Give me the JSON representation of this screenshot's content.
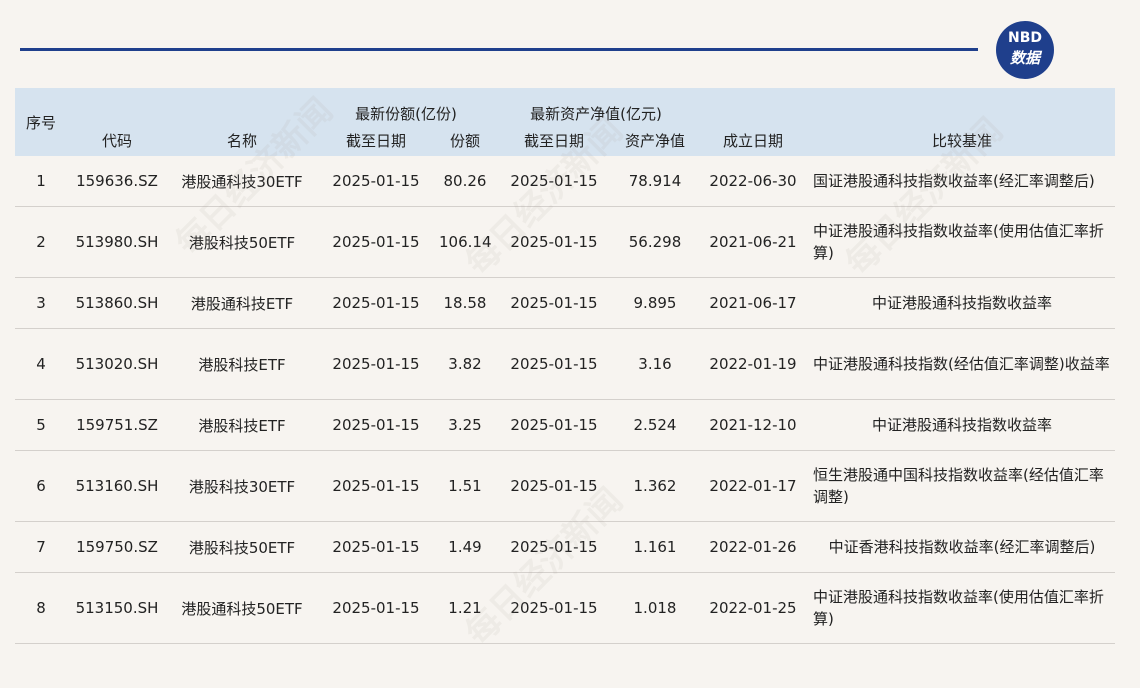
{
  "logo": {
    "top": "NBD",
    "bottom": "数据"
  },
  "watermark": "每日经济新闻",
  "table": {
    "headers": {
      "seq": "序号",
      "code": "代码",
      "name": "名称",
      "shares_group": "最新份额(亿份)",
      "shares_date": "截至日期",
      "shares": "份额",
      "nav_group": "最新资产净值(亿元)",
      "nav_date": "截至日期",
      "nav": "资产净值",
      "inception": "成立日期",
      "benchmark": "比较基准"
    },
    "rows": [
      {
        "seq": "1",
        "code": "159636.SZ",
        "name": "港股通科技30ETF",
        "shares_date": "2025-01-15",
        "shares": "80.26",
        "nav_date": "2025-01-15",
        "nav": "78.914",
        "inception": "2022-06-30",
        "benchmark": "国证港股通科技指数收益率(经汇率调整后)"
      },
      {
        "seq": "2",
        "code": "513980.SH",
        "name": "港股科技50ETF",
        "shares_date": "2025-01-15",
        "shares": "106.14",
        "nav_date": "2025-01-15",
        "nav": "56.298",
        "inception": "2021-06-21",
        "benchmark": "中证港股通科技指数收益率(使用估值汇率折算)"
      },
      {
        "seq": "3",
        "code": "513860.SH",
        "name": "港股通科技ETF",
        "shares_date": "2025-01-15",
        "shares": "18.58",
        "nav_date": "2025-01-15",
        "nav": "9.895",
        "inception": "2021-06-17",
        "benchmark": "中证港股通科技指数收益率"
      },
      {
        "seq": "4",
        "code": "513020.SH",
        "name": "港股科技ETF",
        "shares_date": "2025-01-15",
        "shares": "3.82",
        "nav_date": "2025-01-15",
        "nav": "3.16",
        "inception": "2022-01-19",
        "benchmark": "中证港股通科技指数(经估值汇率调整)收益率"
      },
      {
        "seq": "5",
        "code": "159751.SZ",
        "name": "港股科技ETF",
        "shares_date": "2025-01-15",
        "shares": "3.25",
        "nav_date": "2025-01-15",
        "nav": "2.524",
        "inception": "2021-12-10",
        "benchmark": "中证港股通科技指数收益率"
      },
      {
        "seq": "6",
        "code": "513160.SH",
        "name": "港股科技30ETF",
        "shares_date": "2025-01-15",
        "shares": "1.51",
        "nav_date": "2025-01-15",
        "nav": "1.362",
        "inception": "2022-01-17",
        "benchmark": "恒生港股通中国科技指数收益率(经估值汇率调整)"
      },
      {
        "seq": "7",
        "code": "159750.SZ",
        "name": "港股科技50ETF",
        "shares_date": "2025-01-15",
        "shares": "1.49",
        "nav_date": "2025-01-15",
        "nav": "1.161",
        "inception": "2022-01-26",
        "benchmark": "中证香港科技指数收益率(经汇率调整后)"
      },
      {
        "seq": "8",
        "code": "513150.SH",
        "name": "港股通科技50ETF",
        "shares_date": "2025-01-15",
        "shares": "1.21",
        "nav_date": "2025-01-15",
        "nav": "1.018",
        "inception": "2022-01-25",
        "benchmark": "中证港股通科技指数收益率(使用估值汇率折算)"
      }
    ]
  },
  "chart_data": {
    "type": "table",
    "columns": [
      "序号",
      "代码",
      "名称",
      "最新份额(亿份) 截至日期",
      "最新份额(亿份) 份额",
      "最新资产净值(亿元) 截至日期",
      "最新资产净值(亿元) 资产净值",
      "成立日期",
      "比较基准"
    ],
    "rows": [
      [
        "1",
        "159636.SZ",
        "港股通科技30ETF",
        "2025-01-15",
        80.26,
        "2025-01-15",
        78.914,
        "2022-06-30",
        "国证港股通科技指数收益率(经汇率调整后)"
      ],
      [
        "2",
        "513980.SH",
        "港股科技50ETF",
        "2025-01-15",
        106.14,
        "2025-01-15",
        56.298,
        "2021-06-21",
        "中证港股通科技指数收益率(使用估值汇率折算)"
      ],
      [
        "3",
        "513860.SH",
        "港股通科技ETF",
        "2025-01-15",
        18.58,
        "2025-01-15",
        9.895,
        "2021-06-17",
        "中证港股通科技指数收益率"
      ],
      [
        "4",
        "513020.SH",
        "港股科技ETF",
        "2025-01-15",
        3.82,
        "2025-01-15",
        3.16,
        "2022-01-19",
        "中证港股通科技指数(经估值汇率调整)收益率"
      ],
      [
        "5",
        "159751.SZ",
        "港股科技ETF",
        "2025-01-15",
        3.25,
        "2025-01-15",
        2.524,
        "2021-12-10",
        "中证港股通科技指数收益率"
      ],
      [
        "6",
        "513160.SH",
        "港股科技30ETF",
        "2025-01-15",
        1.51,
        "2025-01-15",
        1.362,
        "2022-01-17",
        "恒生港股通中国科技指数收益率(经估值汇率调整)"
      ],
      [
        "7",
        "159750.SZ",
        "港股科技50ETF",
        "2025-01-15",
        1.49,
        "2025-01-15",
        1.161,
        "2022-01-26",
        "中证香港科技指数收益率(经汇率调整后)"
      ],
      [
        "8",
        "513150.SH",
        "港股通科技50ETF",
        "2025-01-15",
        1.21,
        "2025-01-15",
        1.018,
        "2022-01-25",
        "中证港股通科技指数收益率(使用估值汇率折算)"
      ]
    ]
  }
}
